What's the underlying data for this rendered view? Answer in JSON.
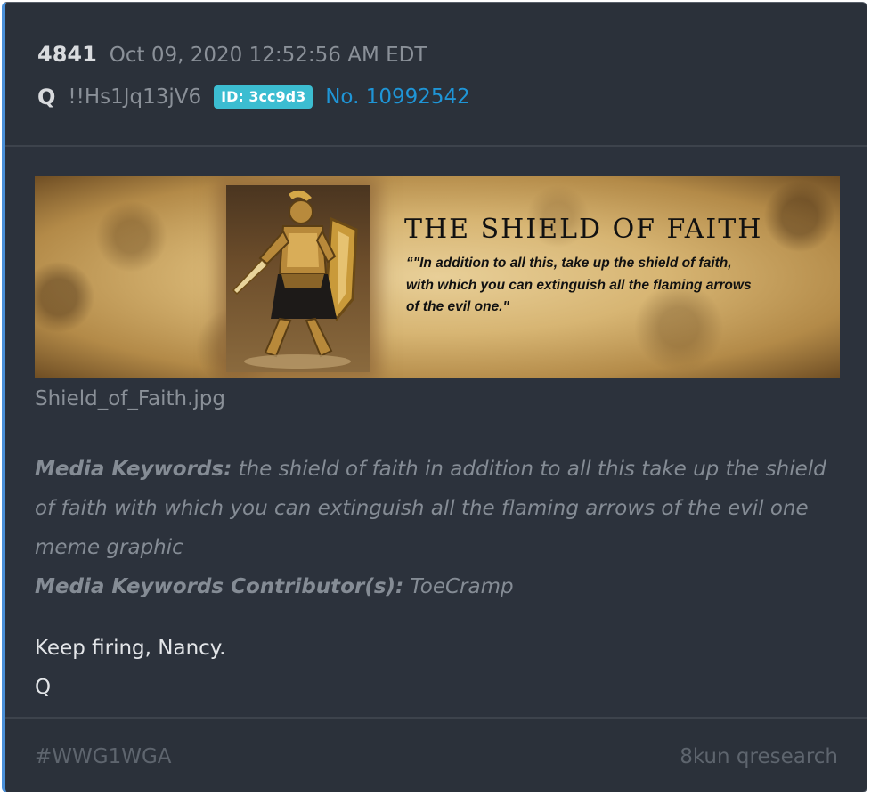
{
  "post": {
    "number": "4841",
    "timestamp": "Oct 09, 2020 12:52:56 AM EDT",
    "author": "Q",
    "tripcode": "!!Hs1Jq13jV6",
    "id_badge": "ID: 3cc9d3",
    "post_link": "No. 10992542"
  },
  "media": {
    "banner_title": "THE SHIELD OF FAITH",
    "banner_quote_lines": [
      "“\"In addition to all this, take up the shield of faith,",
      "with which you can extinguish all the flaming arrows",
      "of the evil one.\""
    ],
    "filename": "Shield_of_Faith.jpg"
  },
  "keywords": {
    "label": "Media Keywords:",
    "value": "the shield of faith in addition to all this take up the shield of faith with which you can extinguish all the flaming arrows of the evil one meme graphic",
    "contributor_label": "Media Keywords Contributor(s):",
    "contributor_value": "ToeCramp"
  },
  "message": {
    "lines": [
      "Keep firing, Nancy.",
      "Q"
    ]
  },
  "footer": {
    "hashtag": "#WWG1WGA",
    "source": "8kun qresearch"
  },
  "colors": {
    "accent_border": "#4a90d9",
    "id_badge_bg": "#3cbdd1",
    "link": "#1f95d6",
    "card_bg": "#2c323c"
  }
}
